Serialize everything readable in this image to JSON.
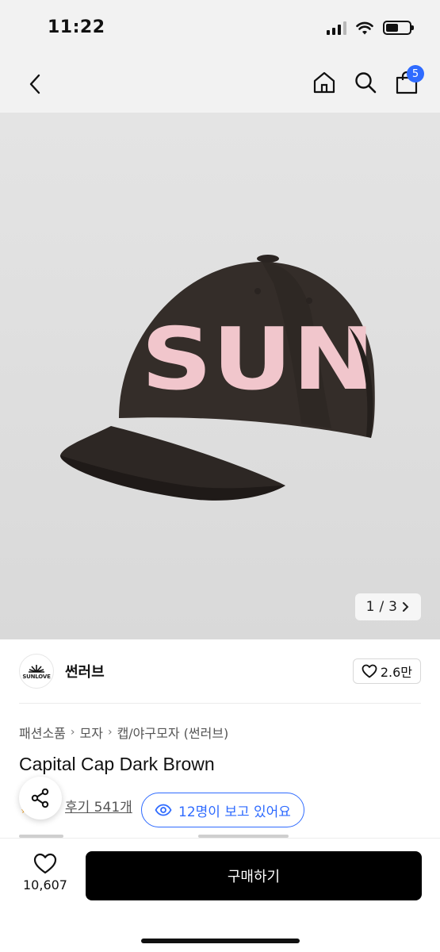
{
  "status_bar": {
    "time": "11:22"
  },
  "nav": {
    "cart_count": "5",
    "icons": [
      "chevron-left-icon",
      "home-icon",
      "search-icon",
      "shopping-bag-icon"
    ]
  },
  "gallery": {
    "current": "1",
    "total": "3",
    "separator": "/",
    "image_subject": "dark brown baseball cap with pink SUN letters",
    "cap_lettering": "SUN"
  },
  "brand": {
    "name": "썬러브",
    "logo_text": "SUNLOVE",
    "likes": "2.6만"
  },
  "breadcrumb": [
    "패션소품",
    "모자",
    "캡/야구모자 (썬러브)"
  ],
  "product": {
    "title": "Capital Cap Dark Brown",
    "review_label": "후기 541개",
    "viewers_label": "12명이 보고 있어요"
  },
  "bottom_bar": {
    "wish_count": "10,607",
    "buy_label": "구매하기"
  },
  "colors": {
    "accent": "#2f6bff",
    "cap": "#332c28",
    "letters": "#f1c6cc",
    "buy_button": "#000000"
  }
}
